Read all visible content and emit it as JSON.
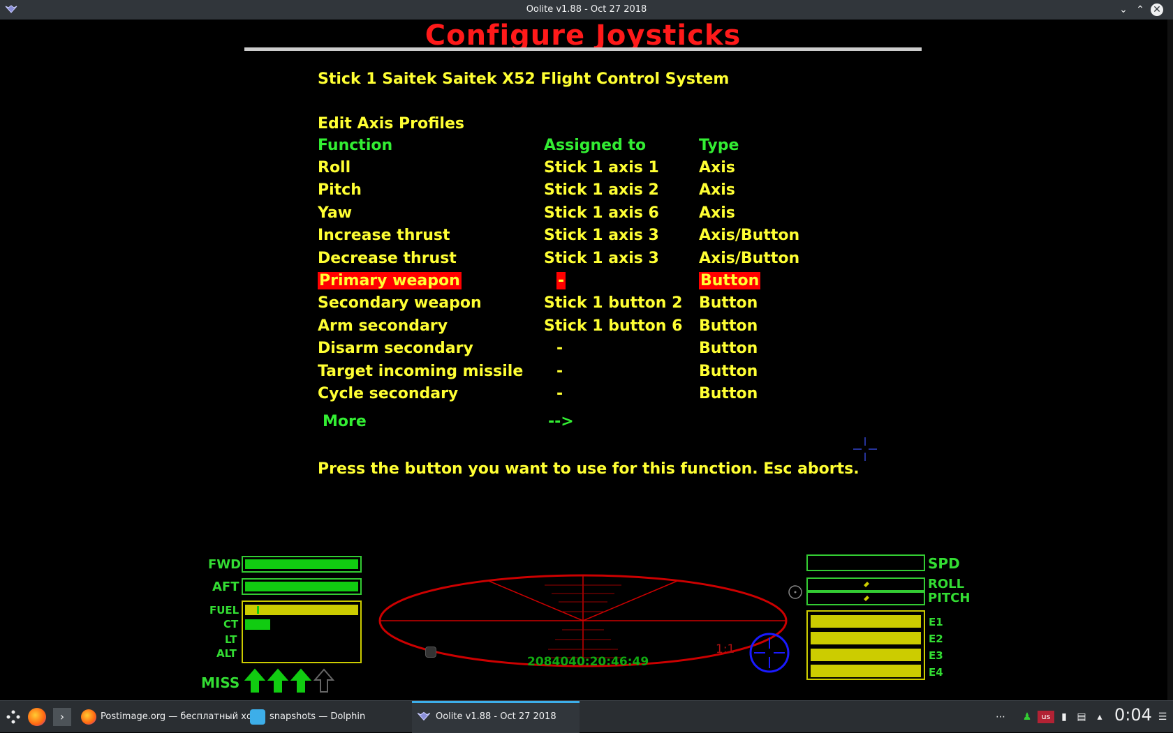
{
  "window": {
    "title": "Oolite v1.88 - Oct 27 2018",
    "minimize_glyph": "⌄",
    "maximize_glyph": "⌃",
    "close_glyph": "✕"
  },
  "screen": {
    "heading": "Configure Joysticks",
    "stick_name": "Stick 1 Saitek Saitek X52 Flight Control System",
    "section_title": "Edit Axis Profiles",
    "columns": {
      "function": "Function",
      "assigned": "Assigned to",
      "type": "Type"
    },
    "rows": [
      {
        "function": "Roll",
        "assigned": "Stick 1 axis 1",
        "type": "Axis"
      },
      {
        "function": "Pitch",
        "assigned": "Stick 1 axis 2",
        "type": "Axis"
      },
      {
        "function": "Yaw",
        "assigned": "Stick 1 axis 6",
        "type": "Axis"
      },
      {
        "function": "Increase thrust",
        "assigned": "Stick 1 axis 3",
        "type": "Axis/Button"
      },
      {
        "function": "Decrease thrust",
        "assigned": "Stick 1 axis 3",
        "type": "Axis/Button"
      },
      {
        "function": "Primary weapon",
        "assigned": "-",
        "type": "Button"
      },
      {
        "function": "Secondary weapon",
        "assigned": "Stick 1 button 2",
        "type": "Button"
      },
      {
        "function": "Arm secondary",
        "assigned": "Stick 1 button 6",
        "type": "Button"
      },
      {
        "function": "Disarm secondary",
        "assigned": "-",
        "type": "Button"
      },
      {
        "function": "Target incoming missile",
        "assigned": "-",
        "type": "Button"
      },
      {
        "function": "Cycle secondary",
        "assigned": "-",
        "type": "Button"
      }
    ],
    "selected_row": "Primary weapon",
    "more_label": "More",
    "more_arrow": "-->",
    "prompt": "Press the button you want to use for this function. Esc aborts."
  },
  "hud": {
    "left_labels": {
      "fwd": "FWD",
      "aft": "AFT",
      "fuel": "FUEL",
      "ct": "CT",
      "lt": "LT",
      "alt": "ALT",
      "miss": "MISS"
    },
    "fwd_shield": 1.0,
    "aft_shield": 1.0,
    "fuel_level": 1.0,
    "cabin_temp": 0.2,
    "missiles_loaded": 3,
    "missiles_total": 4,
    "clock": "2084040:20:46:49",
    "scanner_zoom": "1:1",
    "right_labels": {
      "spd": "SPD",
      "roll": "ROLL",
      "pitch": "PITCH",
      "e1": "E1",
      "e2": "E2",
      "e3": "E3",
      "e4": "E4"
    },
    "speed": 0,
    "energy_banks": [
      1.0,
      1.0,
      1.0,
      1.0
    ],
    "colors": {
      "hud_green": "#33dd33",
      "scanner_red": "#cc0000",
      "energy_yellow": "#cccc00",
      "compass_blue": "#1a1aff"
    }
  },
  "taskbar": {
    "tasks": [
      {
        "label": "Postimage.org — бесплатный хо...",
        "icon": "firefox-icon"
      },
      {
        "label": "snapshots — Dolphin",
        "icon": "folder-icon"
      },
      {
        "label": "Oolite v1.88 - Oct 27 2018",
        "icon": "oolite-icon",
        "active": true
      }
    ],
    "tray_icons": [
      "more-icon",
      "user-icon",
      "keyboard-layout-icon",
      "usb-icon",
      "clipboard-icon",
      "expand-tray-icon",
      "menu-icon"
    ],
    "keyboard_layout": "us",
    "clock": "0:04"
  }
}
